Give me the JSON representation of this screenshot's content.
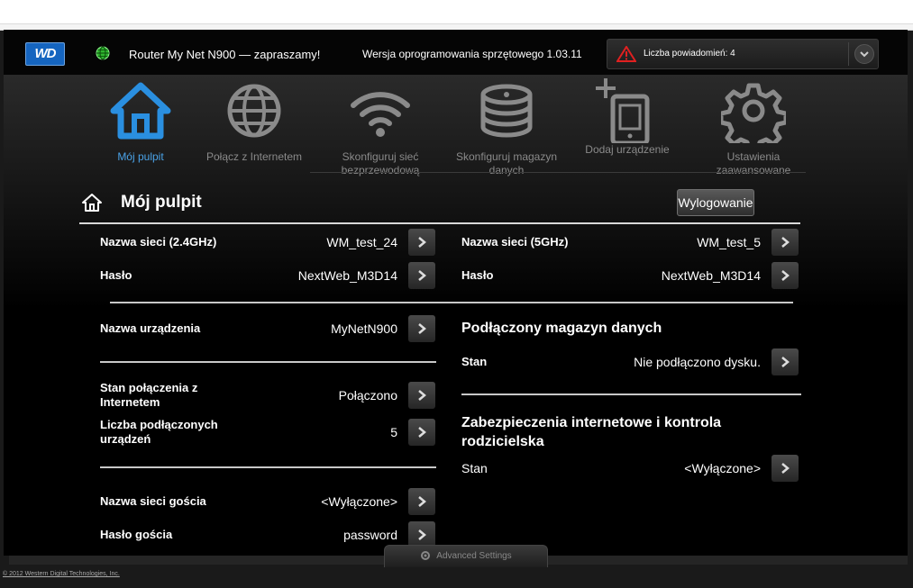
{
  "header": {
    "logo_text": "WD",
    "welcome": "Router My Net N900 — zapraszamy!",
    "firmware": "Wersja oprogramowania sprzętowego 1.03.11",
    "notifications": "Liczba powiadomień: 4"
  },
  "nav": {
    "items": [
      {
        "label": "Mój pulpit"
      },
      {
        "label": "Połącz z Internetem"
      },
      {
        "label_line1": "Skonfiguruj sieć",
        "label_line2": "bezprzewodową"
      },
      {
        "label_line1": "Skonfiguruj magazyn",
        "label_line2": "danych"
      },
      {
        "label": "Dodaj urządzenie"
      },
      {
        "label_line1": "Ustawienia",
        "label_line2": "zaawansowane"
      }
    ]
  },
  "page": {
    "title": "Mój pulpit",
    "logout": "Wylogowanie"
  },
  "left": {
    "network_24": {
      "label": "Nazwa sieci (2.4GHz)",
      "value": "WM_test_24"
    },
    "password_24": {
      "label": "Hasło",
      "value": "NextWeb_M3D14"
    },
    "device_name": {
      "label": "Nazwa urządzenia",
      "value": "MyNetN900"
    },
    "internet_status": {
      "label_line1": "Stan połączenia z",
      "label_line2": "Internetem",
      "value": "Połączono"
    },
    "connected_devices": {
      "label_line1": "Liczba podłączonych",
      "label_line2": "urządzeń",
      "value": "5"
    },
    "guest_network": {
      "label": "Nazwa sieci gościa",
      "value": "<Wyłączone>"
    },
    "guest_password": {
      "label": "Hasło gościa",
      "value": "password"
    }
  },
  "right": {
    "network_5": {
      "label": "Nazwa sieci (5GHz)",
      "value": "WM_test_5"
    },
    "password_5": {
      "label": "Hasło",
      "value": "NextWeb_M3D14"
    },
    "storage": {
      "title": "Podłączony magazyn danych",
      "status_label": "Stan",
      "status_value": "Nie podłączono dysku."
    },
    "security": {
      "title_line1": "Zabezpieczenia internetowe i kontrola",
      "title_line2": "rodzicielska",
      "status_label": "Stan",
      "status_value": "<Wyłączone>"
    }
  },
  "footer": {
    "advanced": "Advanced Settings",
    "copyright": "© 2012 Western Digital Technologies, Inc."
  },
  "colors": {
    "active_nav": "#4aa3e8",
    "inactive_nav": "#8a8a8a",
    "status_ok": "#3fc23f",
    "warning": "#e02020"
  }
}
